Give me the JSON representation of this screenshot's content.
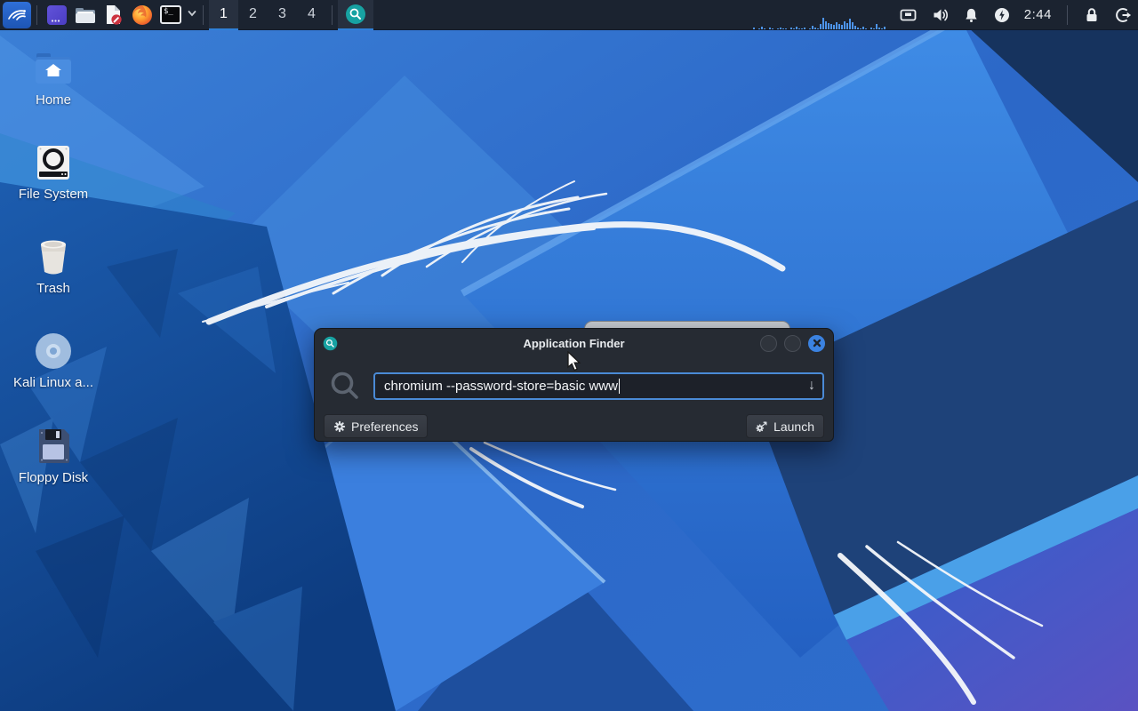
{
  "panel": {
    "launchers": [
      {
        "name": "kali-menu"
      },
      {
        "name": "files-app"
      },
      {
        "name": "file-manager"
      },
      {
        "name": "text-editor"
      },
      {
        "name": "firefox"
      },
      {
        "name": "terminal",
        "glyph": "$_"
      }
    ],
    "workspaces": [
      "1",
      "2",
      "3",
      "4"
    ],
    "active_workspace": "1",
    "taskbar_window": "Application Finder",
    "clock": "2:44",
    "cpu_graph": {
      "bars": [
        2,
        0,
        1,
        3,
        1,
        0,
        2,
        1,
        0,
        1,
        2,
        1,
        1,
        0,
        2,
        1,
        3,
        1,
        1,
        2,
        0,
        1,
        4,
        2,
        1,
        6,
        13,
        9,
        7,
        6,
        5,
        8,
        6,
        5,
        9,
        7,
        12,
        8,
        4,
        2,
        1,
        3,
        1,
        0,
        2,
        1,
        6,
        2,
        1,
        3
      ]
    }
  },
  "desktop": {
    "icons": [
      {
        "label": "Home"
      },
      {
        "label": "File System"
      },
      {
        "label": "Trash"
      },
      {
        "label": "Kali Linux a..."
      },
      {
        "label": "Floppy Disk"
      }
    ]
  },
  "appfinder": {
    "title": "Application Finder",
    "search_value": "chromium --password-store=basic www",
    "combo_arrow": "↓",
    "preferences_label": "Preferences",
    "launch_label": "Launch"
  },
  "colors": {
    "accent": "#3584e4",
    "teal_app_icon": "#17a2a2",
    "panel_bg": "#1b2330",
    "dialog_bg": "#262b33",
    "input_border": "#4a8ad6",
    "wallpaper_base": "#2f6fd0",
    "close_button": "#3b82e0"
  }
}
